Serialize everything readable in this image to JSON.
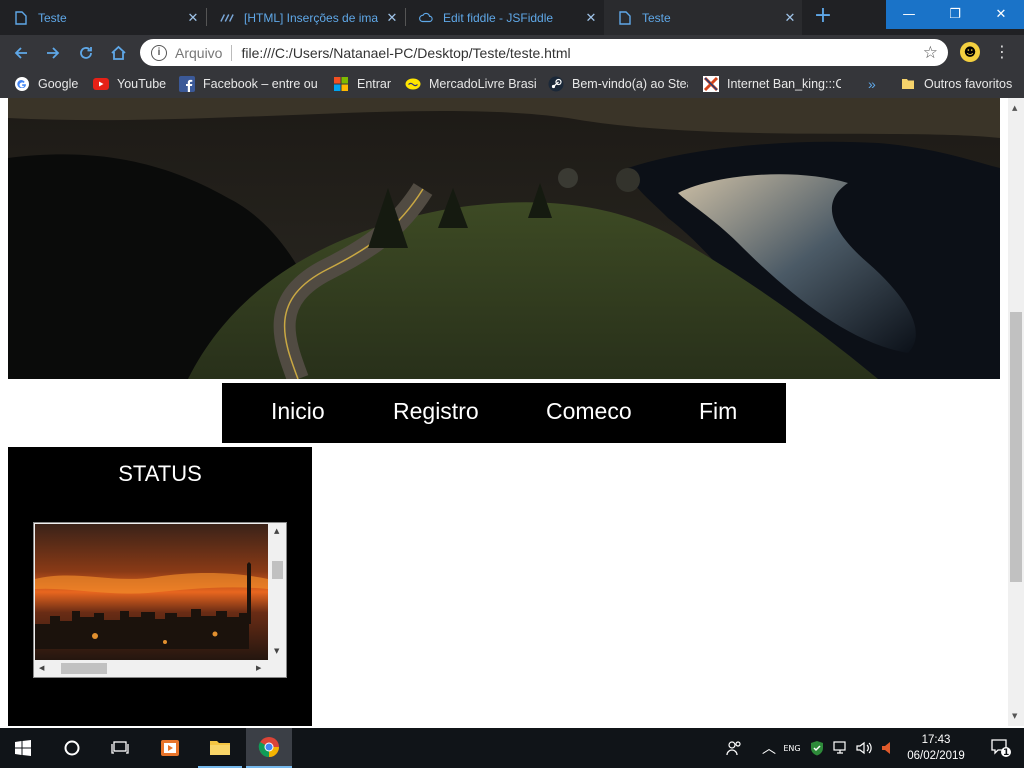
{
  "tabs": [
    {
      "label": "Teste",
      "icon": "document-icon",
      "close": "✕"
    },
    {
      "label": "[HTML] Inserções de ima",
      "icon": "site-logo-icon",
      "close": "✕"
    },
    {
      "label": "Edit fiddle - JSFiddle",
      "icon": "cloud-icon",
      "close": "✕"
    },
    {
      "label": "Teste",
      "icon": "document-icon",
      "close": "✕",
      "active": true
    }
  ],
  "window_controls": {
    "minimize": "—",
    "restore": "❐",
    "close": "✕"
  },
  "address": {
    "chip": "Arquivo",
    "url": "file:///C:/Users/Natanael-PC/Desktop/Teste/teste.html"
  },
  "bookmarks": [
    {
      "label": "Google",
      "icon": "google-icon"
    },
    {
      "label": "YouTube",
      "icon": "youtube-icon"
    },
    {
      "label": "Facebook – entre ou",
      "icon": "facebook-icon"
    },
    {
      "label": "Entrar",
      "icon": "microsoft-icon"
    },
    {
      "label": "MercadoLivre Brasil",
      "icon": "mercadolivre-icon"
    },
    {
      "label": "Bem-vindo(a) ao Stea",
      "icon": "steam-icon"
    },
    {
      "label": "Internet Ban_king:::C",
      "icon": "bank-icon"
    }
  ],
  "bookmarks_more": "»",
  "other_bookmarks": "Outros favoritos",
  "page": {
    "nav": [
      "Inicio",
      "Registro",
      "Comeco",
      "Fim"
    ],
    "status_title": "STATUS"
  },
  "taskbar": {
    "time": "17:43",
    "date": "06/02/2019",
    "notifications": "1",
    "lang": "ENG"
  },
  "colors": {
    "tab_text": "#5fa8e8",
    "window_button": "#1a73c8",
    "toolbar": "#35363a",
    "page_box": "#000000"
  }
}
